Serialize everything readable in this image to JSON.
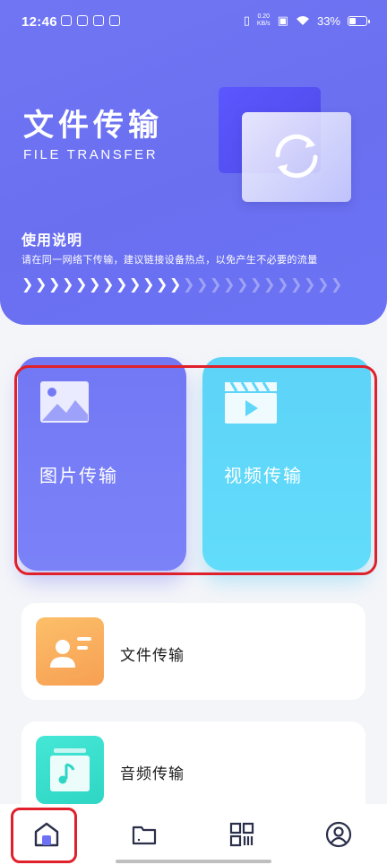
{
  "status_bar": {
    "time": "12:46",
    "net_speed_value": "0.20",
    "net_speed_unit": "KB/s",
    "battery": "33%"
  },
  "hero": {
    "title": "文件传输",
    "subtitle": "FILE TRANSFER",
    "usage_title": "使用说明",
    "usage_text": "请在同一网络下传输，建议链接设备热点，以免产生不必要的流量"
  },
  "cards": {
    "image_transfer": "图片传输",
    "video_transfer": "视频传输",
    "file_transfer": "文件传输",
    "audio_transfer": "音频传输"
  },
  "nav": {
    "items": [
      "home-icon",
      "folder-icon",
      "scan-icon",
      "profile-icon"
    ],
    "active": "home-icon"
  },
  "colors": {
    "hero": "#6c72f2",
    "image_card": "#7479f5",
    "video_card": "#5fd7f9",
    "file_icon": "#f9ab5c",
    "audio_icon": "#3ddfcd",
    "highlight": "#e0202b"
  }
}
